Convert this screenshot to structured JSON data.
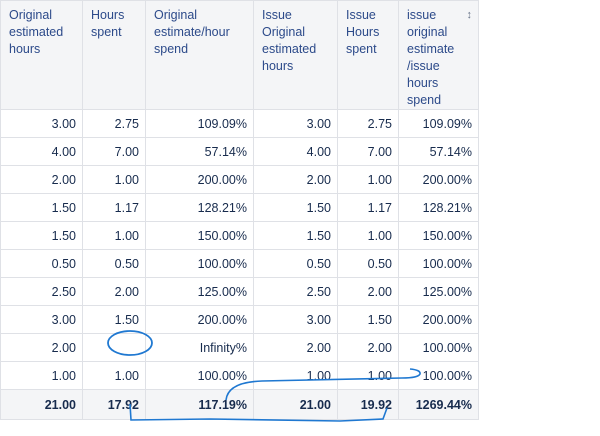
{
  "table": {
    "headers": [
      "Original\nestimated\nhours",
      "Hours\nspent",
      "Original\nestimate/hour\nspend",
      "Issue\nOriginal\nestimated\nhours",
      "Issue\nHours\nspent",
      "issue\noriginal\nestimate\n/issue\nhours\nspend"
    ],
    "sort_icon": "sort-arrows-icon",
    "rows": [
      [
        "3.00",
        "2.75",
        "109.09%",
        "3.00",
        "2.75",
        "109.09%"
      ],
      [
        "4.00",
        "7.00",
        "57.14%",
        "4.00",
        "7.00",
        "57.14%"
      ],
      [
        "2.00",
        "1.00",
        "200.00%",
        "2.00",
        "1.00",
        "200.00%"
      ],
      [
        "1.50",
        "1.17",
        "128.21%",
        "1.50",
        "1.17",
        "128.21%"
      ],
      [
        "1.50",
        "1.00",
        "150.00%",
        "1.50",
        "1.00",
        "150.00%"
      ],
      [
        "0.50",
        "0.50",
        "100.00%",
        "0.50",
        "0.50",
        "100.00%"
      ],
      [
        "2.50",
        "2.00",
        "125.00%",
        "2.50",
        "2.00",
        "125.00%"
      ],
      [
        "3.00",
        "1.50",
        "200.00%",
        "3.00",
        "1.50",
        "200.00%"
      ],
      [
        "2.00",
        "",
        "Infinity%",
        "2.00",
        "2.00",
        "100.00%"
      ],
      [
        "1.00",
        "1.00",
        "100.00%",
        "1.00",
        "1.00",
        "100.00%"
      ]
    ],
    "totals": [
      "21.00",
      "17.92",
      "117.19%",
      "21.00",
      "19.92",
      "1269.44%"
    ]
  },
  "colors": {
    "header_bg": "#f4f5f7",
    "header_text": "#2c4a8a",
    "border": "#dfe1e6",
    "annotation": "#1f78d1"
  }
}
